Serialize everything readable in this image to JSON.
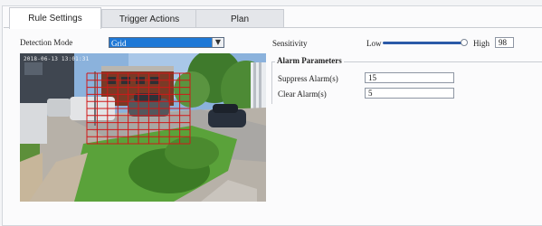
{
  "tabs": [
    {
      "label": "Rule Settings",
      "active": true
    },
    {
      "label": "Trigger Actions",
      "active": false
    },
    {
      "label": "Plan",
      "active": false
    }
  ],
  "detection_mode": {
    "label": "Detection Mode",
    "selected": "Grid"
  },
  "video": {
    "osd_text": "2018-06-13 13:01:31",
    "grid_rows": 10,
    "grid_cols": 10
  },
  "sensitivity": {
    "label": "Sensitivity",
    "low_label": "Low",
    "high_label": "High",
    "value": "98",
    "level": 0.98
  },
  "alarm_parameters": {
    "title": "Alarm Parameters",
    "suppress_label": "Suppress Alarm(s)",
    "suppress_value": "15",
    "clear_label": "Clear Alarm(s)",
    "clear_value": "5"
  },
  "colors": {
    "accent": "#1e78d6",
    "grid": "#d01818",
    "slider": "#2b5aa8"
  }
}
